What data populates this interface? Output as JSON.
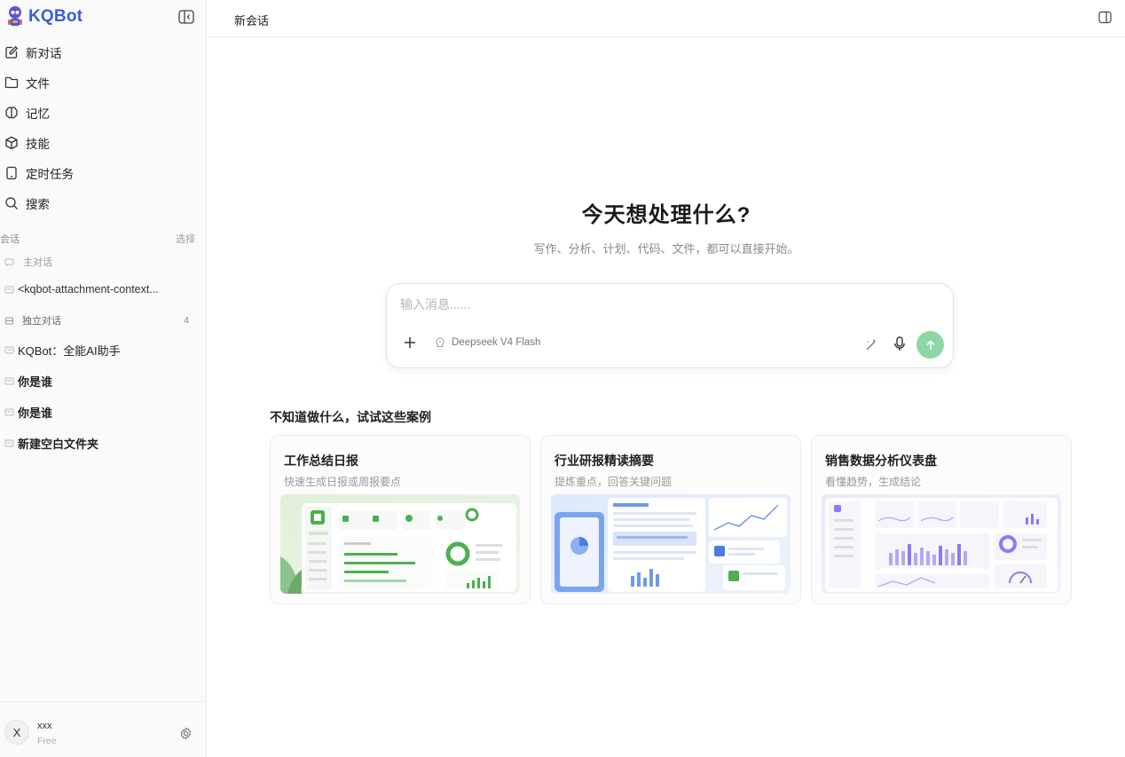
{
  "app": {
    "name": "KQBot"
  },
  "sidebar": {
    "nav": [
      {
        "label": "新对话",
        "icon": "edit-icon"
      },
      {
        "label": "文件",
        "icon": "folder-icon"
      },
      {
        "label": "记忆",
        "icon": "brain-icon"
      },
      {
        "label": "技能",
        "icon": "cube-icon"
      },
      {
        "label": "定时任务",
        "icon": "phone-icon"
      },
      {
        "label": "搜索",
        "icon": "search-icon"
      }
    ],
    "section_label": "会话",
    "section_action": "选择",
    "conversations": [
      {
        "label": "主对话"
      },
      {
        "label": "<kqbot-attachment-context..."
      },
      {
        "label": "独立对话",
        "count": "4"
      },
      {
        "label": "KQBot：全能AI助手"
      },
      {
        "label": "你是谁"
      },
      {
        "label": "你是谁"
      },
      {
        "label": "新建空白文件夹"
      }
    ],
    "user": {
      "initial": "X",
      "name": "xxx",
      "plan": "Free"
    }
  },
  "topbar": {
    "title": "新会话"
  },
  "hero": {
    "title": "今天想处理什么?",
    "subtitle": "写作、分析、计划、代码、文件，都可以直接开始。"
  },
  "composer": {
    "placeholder": "输入消息......",
    "value": "",
    "model": "Deepseek V4 Flash"
  },
  "examples": {
    "title": "不知道做什么，试试这些案例",
    "cards": [
      {
        "title": "工作总结日报",
        "subtitle": "快速生成日报或周报要点",
        "accent": "#4caf50"
      },
      {
        "title": "行业研报精读摘要",
        "subtitle": "提炼重点，回答关键问题",
        "accent": "#5b8def"
      },
      {
        "title": "销售数据分析仪表盘",
        "subtitle": "看懂趋势，生成结论",
        "accent": "#8a7cf0"
      }
    ]
  },
  "colors": {
    "brand": "#3b5bdb",
    "send": "#8ed6a6"
  }
}
